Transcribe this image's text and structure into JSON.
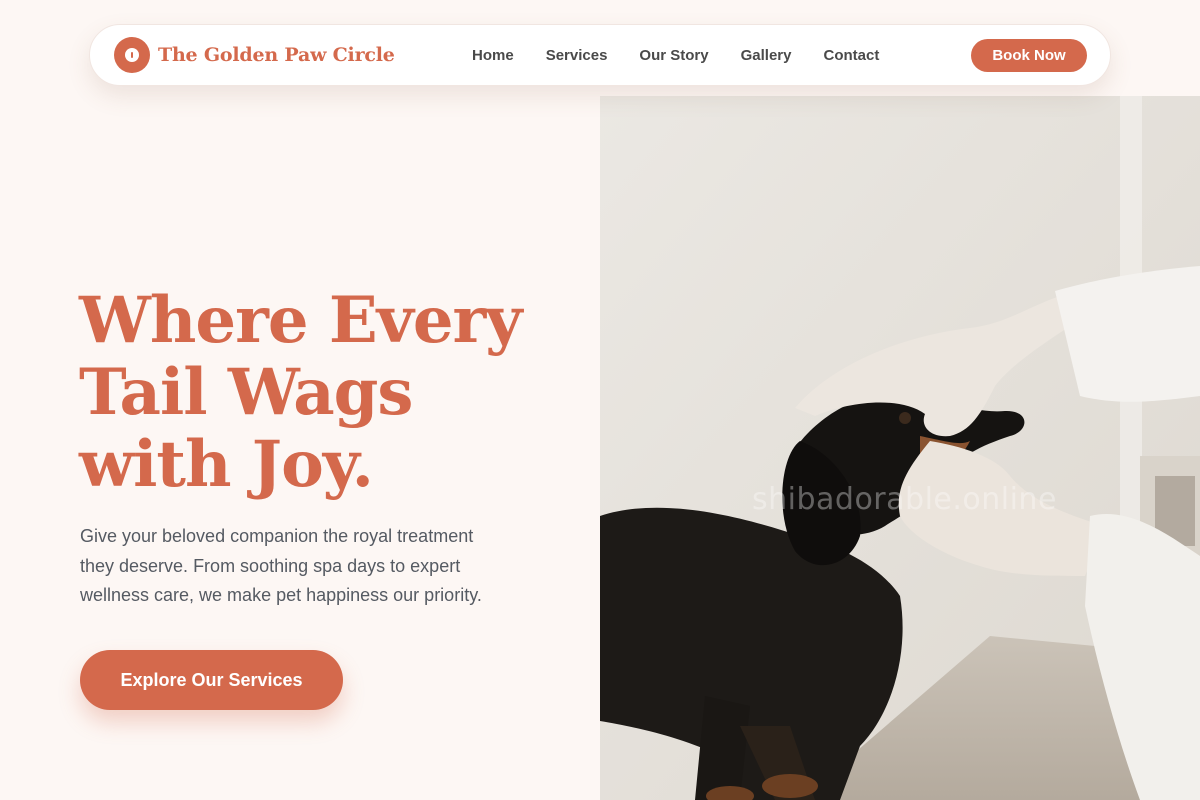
{
  "brand": {
    "name": "The Golden Paw Circle",
    "icon": "paw-logo-icon",
    "accent_color": "#d4694c"
  },
  "nav": {
    "items": [
      {
        "label": "Home"
      },
      {
        "label": "Services"
      },
      {
        "label": "Our Story"
      },
      {
        "label": "Gallery"
      },
      {
        "label": "Contact"
      }
    ],
    "cta_label": "Book Now"
  },
  "hero": {
    "title_lines": [
      "Where Every",
      "Tail Wags",
      "with Joy."
    ],
    "description_lines": [
      "Give your beloved companion the royal treatment",
      "they deserve. From soothing spa days to expert",
      "wellness care, we make pet happiness our priority."
    ],
    "cta_label": "Explore Our Services",
    "image": {
      "subject": "dachshund-being-examined-by-gloved-hands",
      "watermark": "shibadorable.online"
    }
  }
}
